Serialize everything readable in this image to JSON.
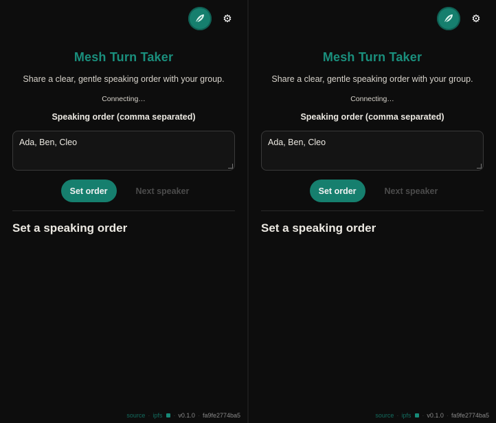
{
  "app": {
    "title": "Mesh Turn Taker",
    "subtitle": "Share a clear, gentle speaking order with your group.",
    "status": "Connecting…",
    "order_label": "Speaking order (comma separated)",
    "order_value": "Ada, Ben, Cleo",
    "set_order_label": "Set order",
    "next_speaker_label": "Next speaker",
    "section_heading": "Set a speaking order",
    "gear_glyph": "⚙",
    "avatar_icon": "feather-icon",
    "footer": {
      "source_label": "source",
      "sep": "·",
      "ipfs_label": "ipfs",
      "version": "v0.1.0",
      "commit": "fa9fe2774ba5"
    }
  },
  "colors": {
    "accent": "#167f6e",
    "title": "#1a8f7d",
    "background": "#0d0d0d",
    "muted_button": "#4b4b4b"
  }
}
